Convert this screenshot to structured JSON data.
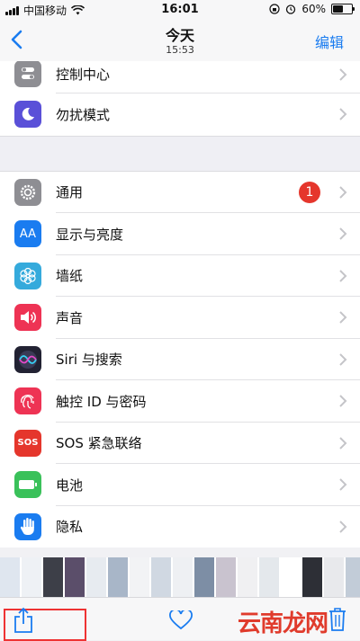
{
  "status_bar": {
    "carrier": "中国移动",
    "time": "16:01",
    "battery_pct": "60%",
    "battery_level": 0.6
  },
  "nav": {
    "back_icon": "chevron-left-icon",
    "title": "今天",
    "subtitle": "15:53",
    "edit_label": "编辑"
  },
  "settings": {
    "top_group": [
      {
        "label": "控制中心",
        "icon": "control-center-icon",
        "color": "#8e8e93"
      },
      {
        "label": "勿扰模式",
        "icon": "moon-icon",
        "color": "#5a50d8"
      }
    ],
    "main_group": [
      {
        "label": "通用",
        "icon": "gear-icon",
        "color": "#8e8e93",
        "badge": "1"
      },
      {
        "label": "显示与亮度",
        "icon": "display-icon",
        "color": "#1a7cf0"
      },
      {
        "label": "墙纸",
        "icon": "wallpaper-flower-icon",
        "color": "#35aadc"
      },
      {
        "label": "声音",
        "icon": "speaker-icon",
        "color": "#ee3354"
      },
      {
        "label": "Siri 与搜索",
        "icon": "siri-icon",
        "color": "#222233"
      },
      {
        "label": "触控 ID 与密码",
        "icon": "fingerprint-icon",
        "color": "#ee3354"
      },
      {
        "label": "SOS 紧急联络",
        "icon": "sos-icon",
        "color": "#e5362c"
      },
      {
        "label": "电池",
        "icon": "battery-icon",
        "color": "#3ac15a"
      },
      {
        "label": "隐私",
        "icon": "hand-icon",
        "color": "#1a7cf0"
      }
    ],
    "aa_text": "AA",
    "sos_text": "SOS",
    "accent_red": "#e5362c"
  },
  "toolbar": {
    "share_icon": "share-icon",
    "heart_icon": "heart-icon",
    "trash_icon": "trash-icon",
    "highlight_color": "#e33333"
  },
  "watermark": "云南龙网"
}
